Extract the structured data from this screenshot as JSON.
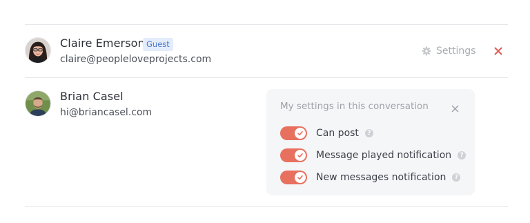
{
  "members": [
    {
      "name": "Claire Emerson",
      "badge": "Guest",
      "email": "claire@peopleloveprojects.com",
      "settings_label": "Settings",
      "avatar_icon": "avatar-claire-photo"
    },
    {
      "name": "Brian Casel",
      "email": "hi@briancasel.com",
      "avatar_icon": "avatar-brian-photo"
    }
  ],
  "popover": {
    "title": "My settings in this conversation",
    "close_icon": "close-icon",
    "settings": [
      {
        "label": "Can post",
        "enabled": true
      },
      {
        "label": "Message played notification",
        "enabled": true
      },
      {
        "label": "New messages notification",
        "enabled": true
      }
    ]
  },
  "colors": {
    "toggle_on": "#e8705f",
    "remove": "#e05a52",
    "badge_bg": "#e3ecfb",
    "badge_text": "#4d77c9",
    "popover_bg": "#f5f6f8"
  }
}
